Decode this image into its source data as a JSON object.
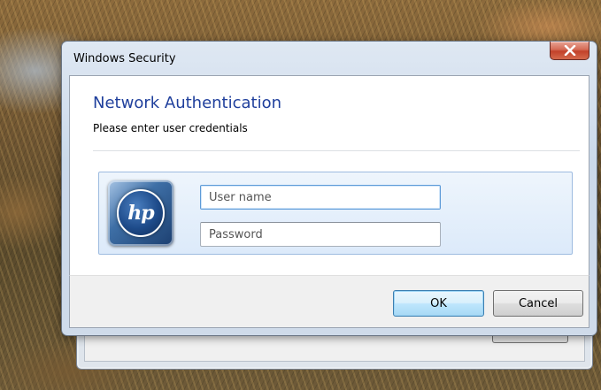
{
  "window": {
    "title": "Windows Security",
    "close_label": "x"
  },
  "content": {
    "heading": "Network Authentication",
    "subheading": "Please enter user credentials"
  },
  "credentials": {
    "logo_text": "hp",
    "username_placeholder": "User name",
    "password_placeholder": "Password",
    "username_value": "",
    "password_value": ""
  },
  "buttons": {
    "ok_label": "OK",
    "cancel_label": "Cancel"
  },
  "colors": {
    "heading": "#1f3f9c",
    "close_button": "#c2412a",
    "panel_border": "#9dbbe0"
  },
  "icons": {
    "close": "close-icon",
    "logo": "hp-logo-icon"
  }
}
